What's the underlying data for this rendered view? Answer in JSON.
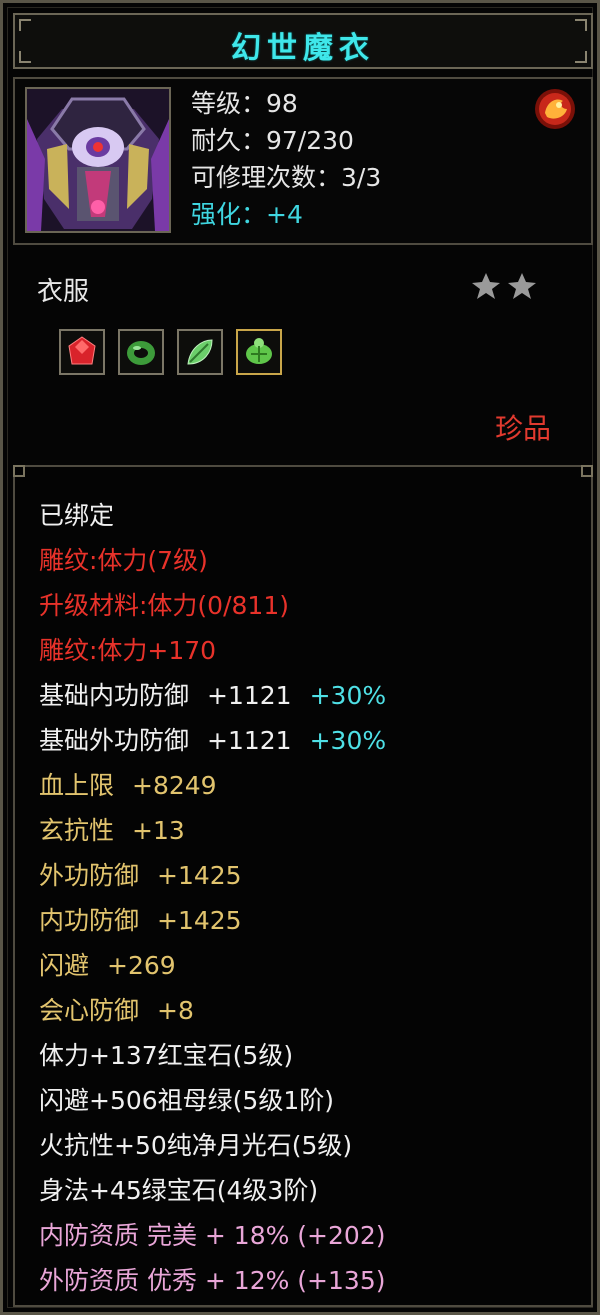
{
  "title": "幻世魔衣",
  "info": {
    "level": "等级：98",
    "durability": "耐久：97/230",
    "repair": "可修理次数：3/3",
    "enhance": "强化：+4"
  },
  "item_type": "衣服",
  "stars": 2,
  "gems": [
    {
      "name": "red-gem-icon",
      "color": "#d9232b"
    },
    {
      "name": "green-jade-ring-icon",
      "color": "#3d9b3a"
    },
    {
      "name": "green-leaf-gem-icon",
      "color": "#6bcf6a"
    },
    {
      "name": "green-turtle-gem-icon",
      "color": "#5fc64a"
    }
  ],
  "rarity": "珍品",
  "details": {
    "bound": "已绑定",
    "engrave": "雕纹:体力(7级)",
    "upgrade": "升级材料:体力(0/811)",
    "engrave_bonus": "雕纹:体力+170",
    "base_inner_def": "基础内功防御",
    "base_inner_def_val": "+1121",
    "base_inner_def_pct": "+30%",
    "base_outer_def": "基础外功防御",
    "base_outer_def_val": "+1121",
    "base_outer_def_pct": "+30%",
    "hp": "血上限",
    "hp_val": "+8249",
    "xuan_res": "玄抗性",
    "xuan_res_val": "+13",
    "outer_def": "外功防御",
    "outer_def_val": "+1425",
    "inner_def": "内功防御",
    "inner_def_val": "+1425",
    "dodge": "闪避",
    "dodge_val": "+269",
    "crit_def": "会心防御",
    "crit_def_val": "+8",
    "gem1": "体力+137红宝石(5级)",
    "gem2": "闪避+506祖母绿(5级1阶)",
    "gem3": "火抗性+50纯净月光石(5级)",
    "gem4": "身法+45绿宝石(4级3阶)",
    "inner_quality": "内防资质 完美 + 18% (+202)",
    "outer_quality": "外防资质 优秀 + 12% (+135)"
  },
  "colors": {
    "title": "#3fe7ea",
    "red": "#e8322a",
    "gold": "#e2c46e",
    "pink": "#e9a6d8",
    "cyan": "#4fe0e6"
  }
}
